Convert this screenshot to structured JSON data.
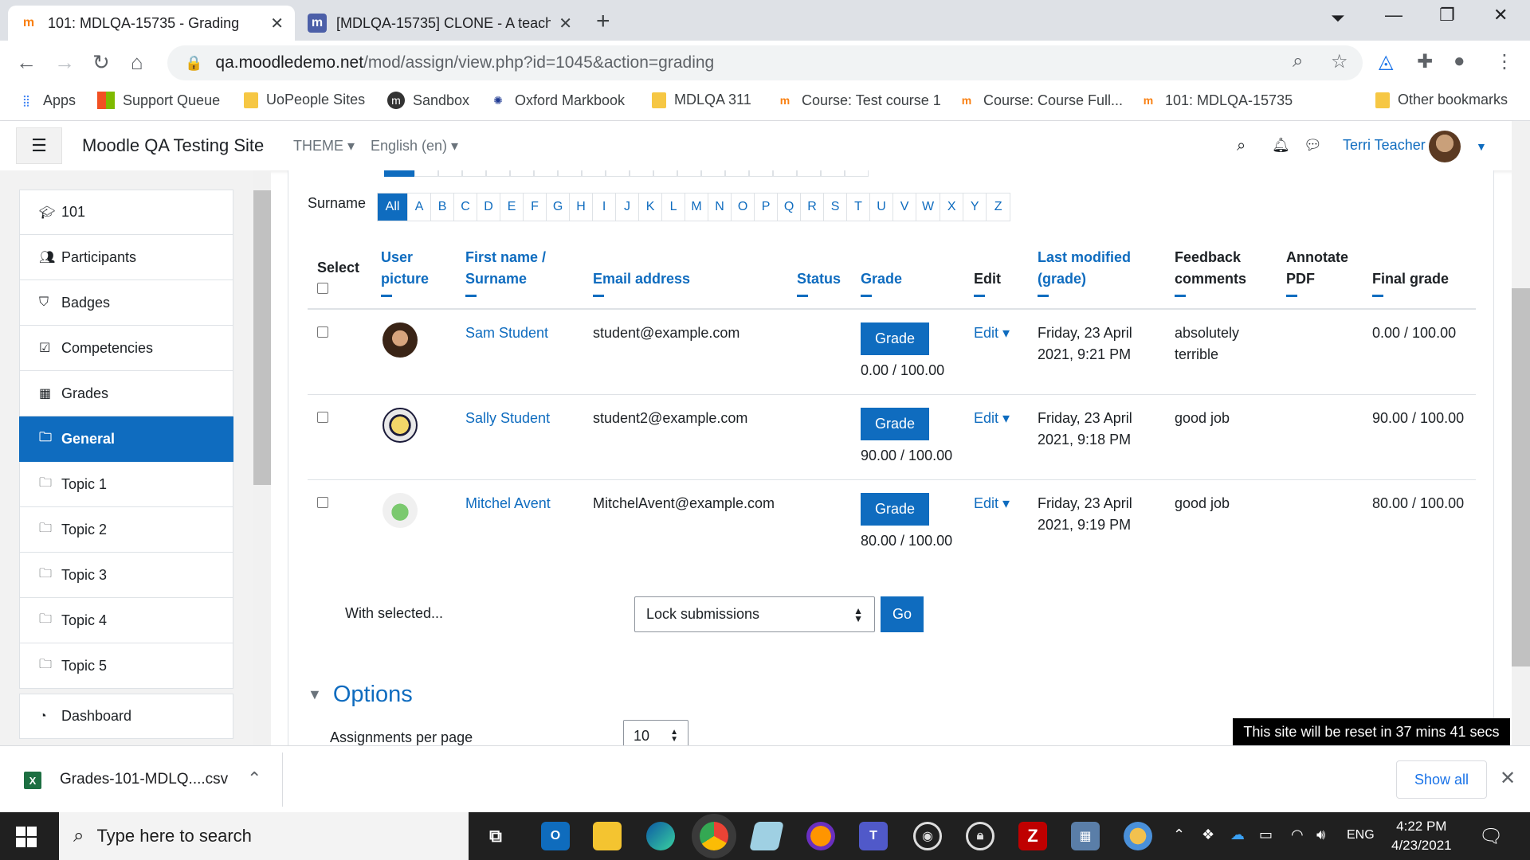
{
  "browser": {
    "tabs": [
      {
        "title": "101: MDLQA-15735 - Grading",
        "favicon": "moodle-favicon"
      },
      {
        "title": "[MDLQA-15735] CLONE - A teach",
        "favicon": "moodle-tracker-favicon"
      }
    ],
    "url_host": "qa.moodledemo.net",
    "url_path": "/mod/assign/view.php?id=1045&action=grading",
    "bookmarks": [
      {
        "label": "Apps",
        "icon": "apps-grid-icon"
      },
      {
        "label": "Support Queue",
        "icon": "windows-logo-icon"
      },
      {
        "label": "UoPeople Sites",
        "icon": "folder-icon"
      },
      {
        "label": "Sandbox",
        "icon": "moodle-circle-icon"
      },
      {
        "label": "Oxford Markbook",
        "icon": "gear-icon"
      },
      {
        "label": "MDLQA 311",
        "icon": "folder-icon"
      },
      {
        "label": "Course: Test course 1",
        "icon": "moodle-favicon"
      },
      {
        "label": "Course: Course Full...",
        "icon": "moodle-favicon"
      },
      {
        "label": "101: MDLQA-15735",
        "icon": "moodle-favicon"
      },
      {
        "label": "Other bookmarks",
        "icon": "folder-icon"
      }
    ]
  },
  "navbar": {
    "site_name": "Moodle QA Testing Site",
    "theme_menu": "THEME",
    "language_menu": "English (en)",
    "user_name": "Terri Teacher"
  },
  "drawer": {
    "items": [
      {
        "label": "101",
        "icon": "graduation-cap-icon"
      },
      {
        "label": "Participants",
        "icon": "users-icon"
      },
      {
        "label": "Badges",
        "icon": "shield-icon"
      },
      {
        "label": "Competencies",
        "icon": "checkbox-icon"
      },
      {
        "label": "Grades",
        "icon": "table-icon"
      },
      {
        "label": "General",
        "icon": "folder-icon",
        "active": true
      },
      {
        "label": "Topic 1",
        "icon": "folder-icon"
      },
      {
        "label": "Topic 2",
        "icon": "folder-icon"
      },
      {
        "label": "Topic 3",
        "icon": "folder-icon"
      },
      {
        "label": "Topic 4",
        "icon": "folder-icon"
      },
      {
        "label": "Topic 5",
        "icon": "folder-icon"
      }
    ],
    "dashboard": {
      "label": "Dashboard",
      "icon": "dashboard-icon"
    }
  },
  "surname_filter": {
    "label": "Surname",
    "letters": [
      "All",
      "A",
      "B",
      "C",
      "D",
      "E",
      "F",
      "G",
      "H",
      "I",
      "J",
      "K",
      "L",
      "M",
      "N",
      "O",
      "P",
      "Q",
      "R",
      "S",
      "T",
      "U",
      "V",
      "W",
      "X",
      "Y",
      "Z"
    ]
  },
  "table": {
    "headers": {
      "select": "Select",
      "user_picture": "User picture",
      "name": "First name / Surname",
      "email": "Email address",
      "status": "Status",
      "grade": "Grade",
      "edit": "Edit",
      "last_modified": "Last modified (grade)",
      "feedback": "Feedback comments",
      "annotate": "Annotate PDF",
      "final_grade": "Final grade"
    },
    "rows": [
      {
        "name": "Sam Student",
        "email": "student@example.com",
        "grade_button": "Grade",
        "grade": "0.00 / 100.00",
        "edit": "Edit",
        "last_modified": "Friday, 23 April 2021, 9:21 PM",
        "feedback": "absolutely terrible",
        "final_grade": "0.00 / 100.00"
      },
      {
        "name": "Sally Student",
        "email": "student2@example.com",
        "grade_button": "Grade",
        "grade": "90.00 / 100.00",
        "edit": "Edit",
        "last_modified": "Friday, 23 April 2021, 9:18 PM",
        "feedback": "good job",
        "final_grade": "90.00 / 100.00"
      },
      {
        "name": "Mitchel Avent",
        "email": "MitchelAvent@example.com",
        "grade_button": "Grade",
        "grade": "80.00 / 100.00",
        "edit": "Edit",
        "last_modified": "Friday, 23 April 2021, 9:19 PM",
        "feedback": "good job",
        "final_grade": "80.00 / 100.00"
      }
    ]
  },
  "bulk": {
    "label": "With selected...",
    "selected_option": "Lock submissions",
    "go_label": "Go"
  },
  "options": {
    "heading": "Options",
    "per_page_label": "Assignments per page",
    "per_page_value": "10"
  },
  "reset_notice": "This site will be reset in 37 mins 41 secs",
  "download_bar": {
    "file_name": "Grades-101-MDLQ....csv",
    "show_all": "Show all"
  },
  "taskbar": {
    "search_placeholder": "Type here to search",
    "language": "ENG",
    "time": "4:22 PM",
    "date": "4/23/2021"
  },
  "colors": {
    "moodle_blue": "#0f6cbf",
    "drawer_bg": "#f2f2f2",
    "taskbar_bg": "#202020"
  }
}
